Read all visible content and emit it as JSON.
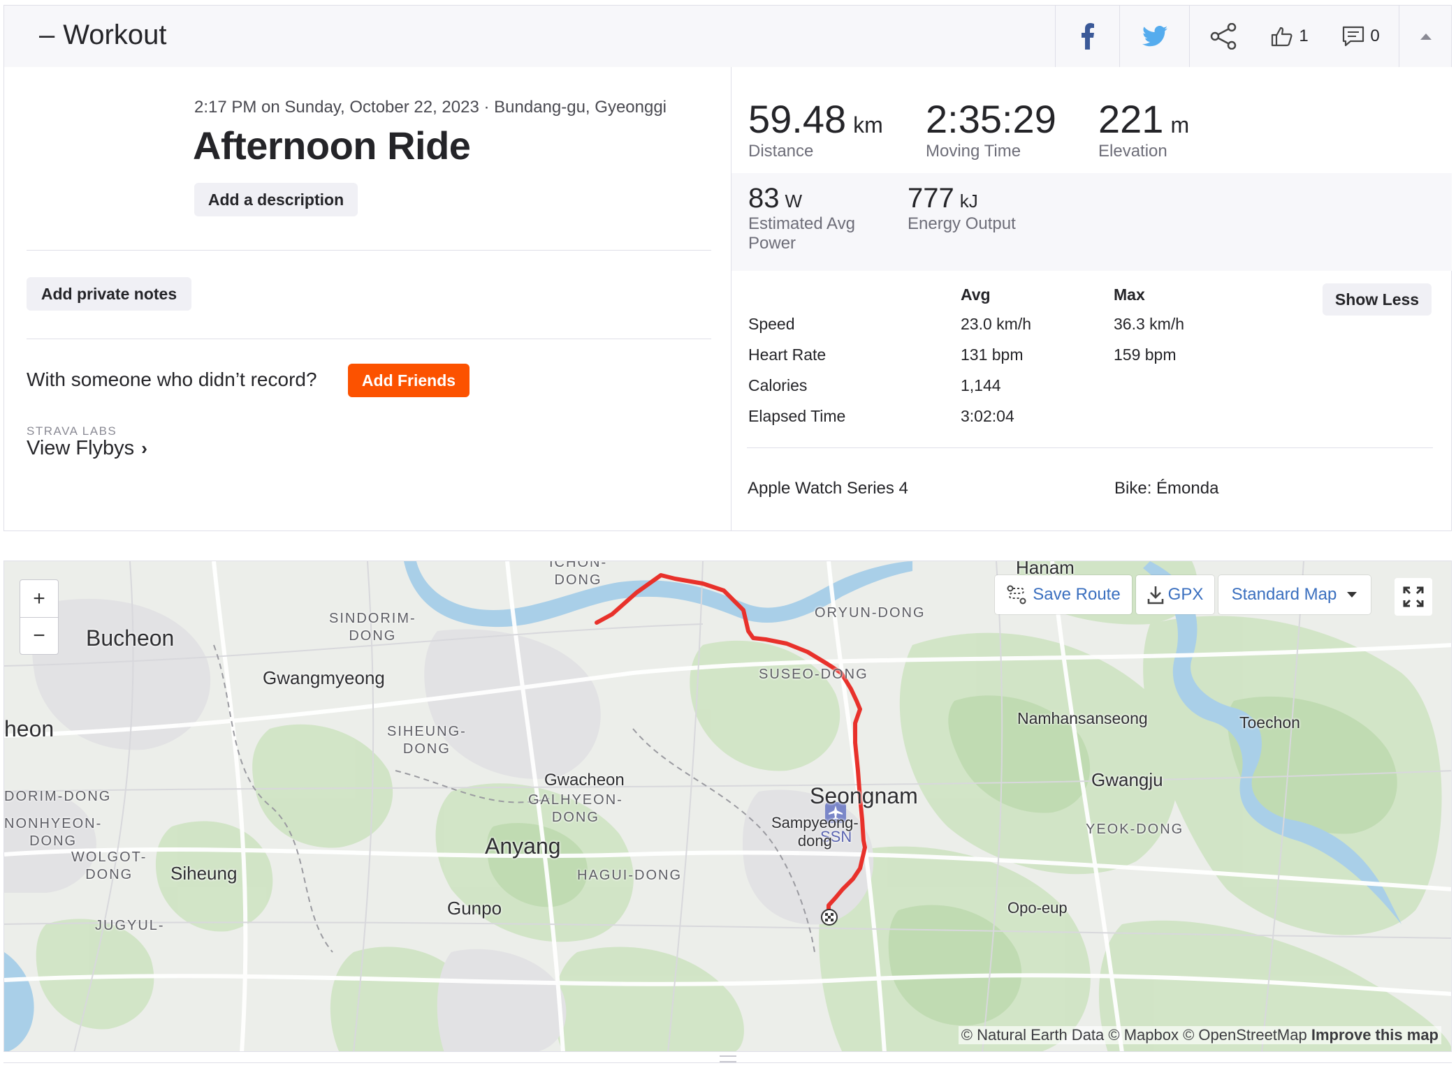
{
  "header": {
    "title": "Workout",
    "collapse_glyph": "–",
    "kudos_count": "1",
    "comments_count": "0",
    "icons": [
      "facebook-icon",
      "twitter-icon",
      "share-icon",
      "kudos-icon",
      "comment-icon",
      "caret-up-icon"
    ],
    "colors": {
      "facebook": "#3b5998",
      "twitter": "#55acee"
    }
  },
  "activity": {
    "meta": "2:17 PM on Sunday, October 22, 2023 · Bundang-gu, Gyeonggi",
    "title": "Afternoon Ride",
    "add_description": "Add a description",
    "add_private_notes": "Add private notes",
    "with_someone": "With someone who didn’t record?",
    "add_friends": "Add Friends",
    "strava_labs": "STRAVA LABS",
    "view_flybys": "View Flybys",
    "accent_color": "#fc5200"
  },
  "stats": {
    "distance": {
      "value": "59.48",
      "unit": "km",
      "label": "Distance"
    },
    "moving_time": {
      "value": "2:35:29",
      "unit": "",
      "label": "Moving Time"
    },
    "elevation": {
      "value": "221",
      "unit": "m",
      "label": "Elevation"
    },
    "power": {
      "value": "83",
      "unit": "W",
      "label": "Estimated Avg Power"
    },
    "energy": {
      "value": "777",
      "unit": "kJ",
      "label": "Energy Output"
    }
  },
  "table": {
    "avg_header": "Avg",
    "max_header": "Max",
    "show_less": "Show Less",
    "rows": [
      {
        "label": "Speed",
        "avg": "23.0 km/h",
        "max": "36.3 km/h"
      },
      {
        "label": "Heart Rate",
        "avg": "131 bpm",
        "max": "159 bpm"
      },
      {
        "label": "Calories",
        "avg": "1,144",
        "max": ""
      },
      {
        "label": "Elapsed Time",
        "avg": "3:02:04",
        "max": ""
      }
    ],
    "device": "Apple Watch Series 4",
    "bike": "Bike: Émonda"
  },
  "map": {
    "zoom_in": "+",
    "zoom_out": "−",
    "save_route": "Save Route",
    "gpx": "GPX",
    "map_style": "Standard Map",
    "attribution": "© Natural Earth Data © Mapbox © OpenStreetMap",
    "improve": "Improve this map",
    "route_color": "#e8312b",
    "labels": {
      "hanam": "Hanam",
      "ichon_dong": "ICHON-\nDONG",
      "oryun_dong": "ORYUN-DONG",
      "sindorim_dong": "SINDORIM-\nDONG",
      "bucheon": "Bucheon",
      "gwangmyeong": "Gwangmyeong",
      "suseo_dong": "SUSEO-DONG",
      "namhansanseong": "Namhansanseong",
      "toechon": "Toechon",
      "heon": "heon",
      "siheung_dong": "SIHEUNG-\nDONG",
      "ssn": "SSN",
      "gwacheon": "Gwacheon",
      "galhyeon_dong": "GALHYEON-\nDONG",
      "seongnam": "Seongnam",
      "gwangju": "Gwangju",
      "dorim_dong": "DORIM-DONG",
      "nonhyeon_dong": "NONHYEON-\nDONG",
      "sampyeong": "Sampyeong-\ndong",
      "yeok_dong": "YEOK-DONG",
      "anyang": "Anyang",
      "wolgot_dong": "WOLGOT-\nDONG",
      "siheung": "Siheung",
      "hagui_dong": "HAGUI-DONG",
      "gunpo": "Gunpo",
      "opo_eup": "Opo-eup",
      "jugyul": "JUGYUL-"
    }
  }
}
